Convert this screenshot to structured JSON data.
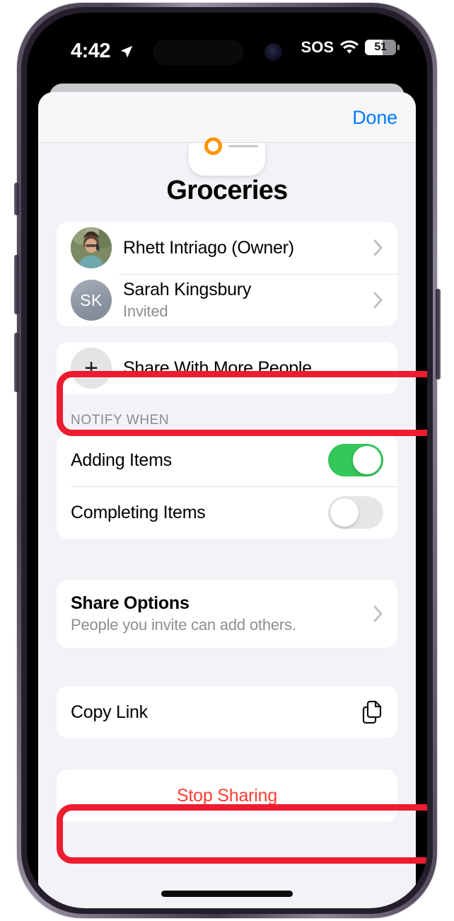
{
  "status_bar": {
    "time": "4:42",
    "location_icon": "location-arrow-icon",
    "sos_label": "SOS",
    "wifi_icon": "wifi-icon",
    "battery_percent": "51"
  },
  "sheet": {
    "done_label": "Done",
    "title": "Groceries",
    "list_icon": "reminders-list-icon"
  },
  "participants": [
    {
      "name": "Rhett Intriago (Owner)",
      "subtitle": "",
      "avatar_type": "photo",
      "initials": ""
    },
    {
      "name": "Sarah Kingsbury",
      "subtitle": "Invited",
      "avatar_type": "initials",
      "initials": "SK"
    }
  ],
  "share_more": {
    "label": "Share With More People",
    "icon": "plus-icon"
  },
  "notify": {
    "section_header": "NOTIFY WHEN",
    "rows": [
      {
        "label": "Adding Items",
        "state": "on"
      },
      {
        "label": "Completing Items",
        "state": "off"
      }
    ]
  },
  "share_options": {
    "title": "Share Options",
    "subtitle": "People you invite can add others."
  },
  "copy_link": {
    "label": "Copy Link",
    "icon": "copy-document-icon"
  },
  "stop_sharing": {
    "label": "Stop Sharing"
  },
  "colors": {
    "accent_blue": "#007AFF",
    "destructive_red": "#FF3B30",
    "toggle_on_green": "#34C759",
    "annotation_red": "#ED1C2E",
    "reminders_orange": "#FF9500",
    "sheet_background": "#F2F2F7"
  }
}
